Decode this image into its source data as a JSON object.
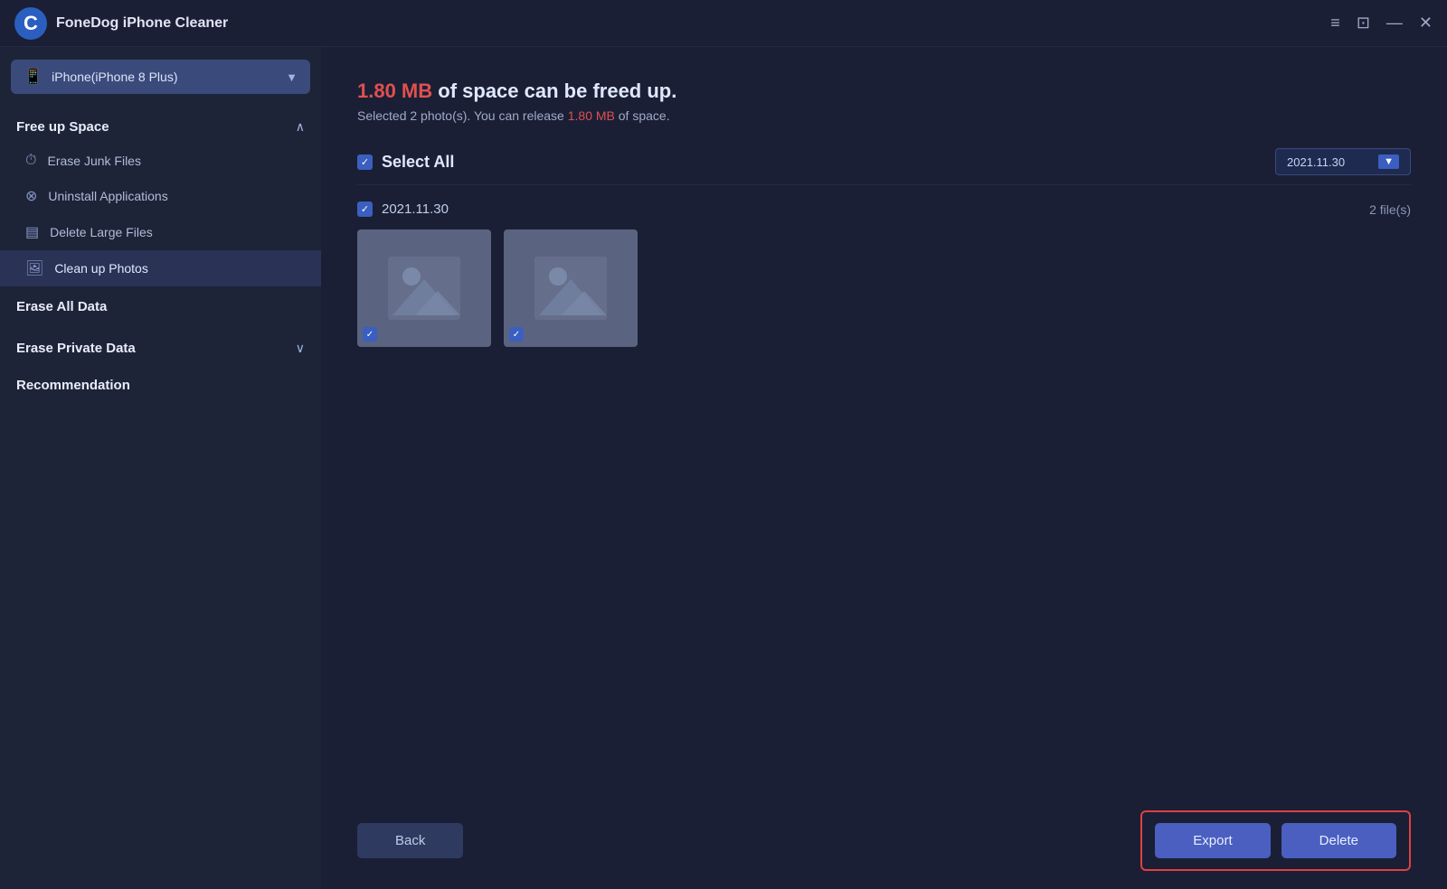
{
  "titlebar": {
    "app_name": "FoneDog iPhone Cleaner",
    "controls": {
      "menu_icon": "☰",
      "chat_icon": "💬",
      "minimize_icon": "—",
      "close_icon": "✕"
    }
  },
  "sidebar": {
    "device": {
      "name": "iPhone(iPhone 8 Plus)",
      "chevron": "▼"
    },
    "sections": [
      {
        "title": "Free up Space",
        "expanded": true,
        "items": [
          {
            "label": "Erase Junk Files",
            "icon": "clock"
          },
          {
            "label": "Uninstall Applications",
            "icon": "circle-x"
          },
          {
            "label": "Delete Large Files",
            "icon": "list"
          },
          {
            "label": "Clean up Photos",
            "icon": "image",
            "active": true
          }
        ]
      },
      {
        "title": "Erase All Data",
        "expanded": false,
        "items": []
      },
      {
        "title": "Erase Private Data",
        "expanded": false,
        "items": []
      },
      {
        "title": "Recommendation",
        "expanded": false,
        "items": []
      }
    ]
  },
  "main": {
    "space_highlight": "1.80 MB",
    "space_title_suffix": " of space can be freed up.",
    "subtitle_prefix": "Selected ",
    "subtitle_count": "2",
    "subtitle_middle": " photo(s). You can release ",
    "subtitle_size": "1.80 MB",
    "subtitle_suffix": " of space.",
    "select_all_label": "Select All",
    "date_dropdown_value": "2021.11.30",
    "date_group": {
      "label": "2021.11.30",
      "count": "2 file(s)"
    },
    "photos": [
      {
        "id": 1,
        "checked": true
      },
      {
        "id": 2,
        "checked": true
      }
    ],
    "back_button": "Back",
    "export_button": "Export",
    "delete_button": "Delete"
  }
}
